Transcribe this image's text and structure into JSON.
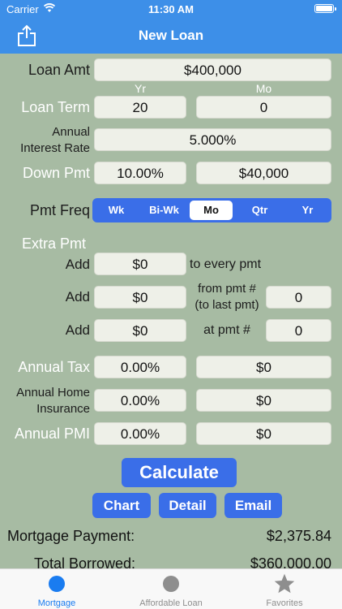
{
  "status": {
    "carrier": "Carrier",
    "time": "11:30 AM"
  },
  "nav": {
    "title": "New Loan"
  },
  "loan_amt": {
    "label": "Loan Amt",
    "value": "$400,000"
  },
  "term": {
    "yr_header": "Yr",
    "mo_header": "Mo",
    "label": "Loan Term",
    "years": "20",
    "months": "0"
  },
  "interest": {
    "label_line1": "Annual",
    "label_line2": "Interest Rate",
    "value": "5.000%"
  },
  "down": {
    "label": "Down Pmt",
    "percent": "10.00%",
    "amount": "$40,000"
  },
  "pmt_freq": {
    "label": "Pmt Freq",
    "options": [
      "Wk",
      "Bi-Wk",
      "Mo",
      "Qtr",
      "Yr"
    ],
    "selected": "Mo"
  },
  "extra": {
    "header": "Extra Pmt",
    "add_label": "Add",
    "every": {
      "amount": "$0",
      "suffix": "to every pmt"
    },
    "from": {
      "amount": "$0",
      "suffix_line1": "from pmt #",
      "suffix_line2": "(to last pmt)",
      "pmt_no": "0"
    },
    "at": {
      "amount": "$0",
      "suffix": "at pmt #",
      "pmt_no": "0"
    }
  },
  "tax": {
    "label": "Annual Tax",
    "percent": "0.00%",
    "amount": "$0"
  },
  "insurance": {
    "label_line1": "Annual Home",
    "label_line2": "Insurance",
    "percent": "0.00%",
    "amount": "$0"
  },
  "pmi": {
    "label": "Annual PMI",
    "percent": "0.00%",
    "amount": "$0"
  },
  "buttons": {
    "calculate": "Calculate",
    "chart": "Chart",
    "detail": "Detail",
    "email": "Email"
  },
  "results": {
    "mortgage_label": "Mortgage Payment:",
    "mortgage_value": "$2,375.84",
    "borrowed_label": "Total Borrowed:",
    "borrowed_value": "$360,000.00"
  },
  "tabs": [
    {
      "label": "Mortgage",
      "color": "#1a7cf0"
    },
    {
      "label": "Affordable Loan",
      "color": "#8e8e8e"
    },
    {
      "label": "Favorites",
      "color": "#8e8e8e"
    }
  ],
  "colors": {
    "accent": "#3d8fe8",
    "button": "#3a6ee8",
    "background": "#a7bba3"
  }
}
